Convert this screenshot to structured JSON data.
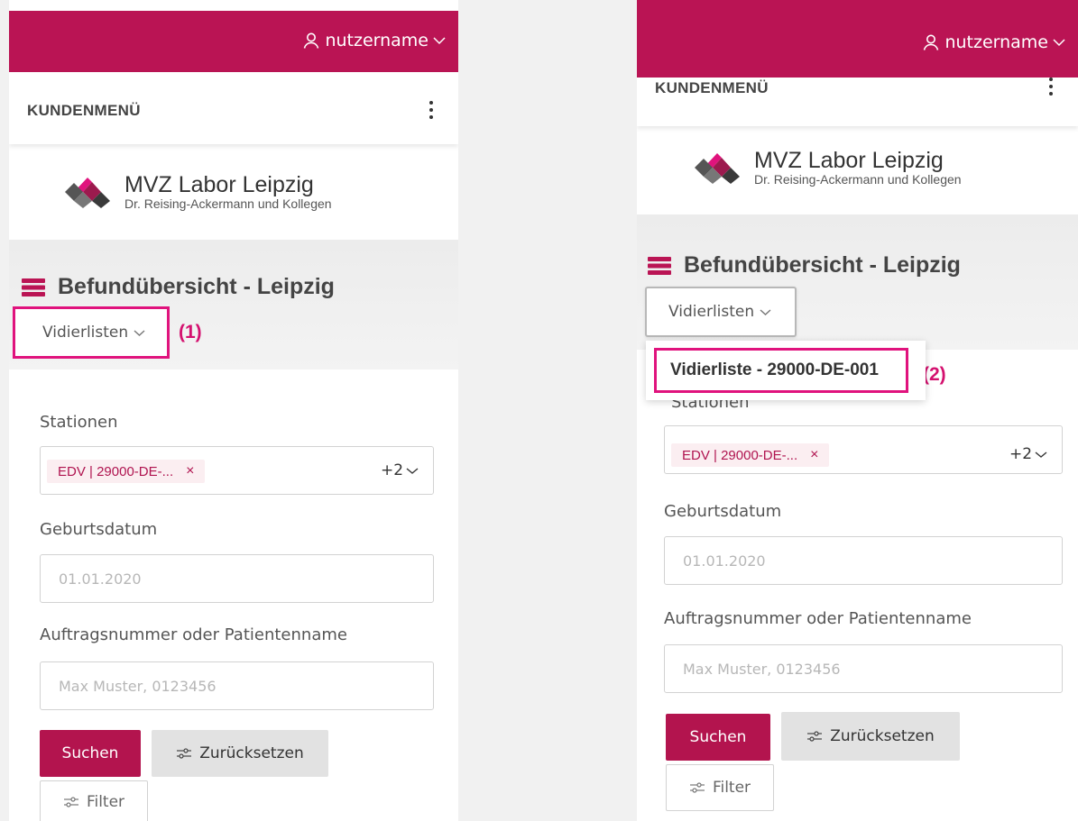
{
  "header": {
    "username": "nutzername"
  },
  "menu": {
    "title": "KUNDENMENÜ"
  },
  "logo": {
    "name": "MVZ Labor Leipzig",
    "subtitle": "Dr. Reising-Ackermann und Kollegen"
  },
  "page": {
    "title": "Befundübersicht - Leipzig"
  },
  "vidierlisten": {
    "label": "Vidierlisten",
    "items": [
      "Vidierliste - 29000-DE-001"
    ]
  },
  "annotations": [
    "(1)",
    "(2)"
  ],
  "form": {
    "stationen_label": "Stationen",
    "station_tag": "EDV | 29000-DE-...",
    "station_tag_remove": "×",
    "station_more": "+2",
    "geburtsdatum_label": "Geburtsdatum",
    "geburtsdatum_placeholder": "01.01.2020",
    "auftrag_label": "Auftragsnummer oder Patientenname",
    "auftrag_placeholder": "Max Muster, 0123456",
    "search_label": "Suchen",
    "reset_label": "Zurücksetzen",
    "filter_label": "Filter"
  },
  "colors": {
    "brand": "#ba1454",
    "highlight": "#e0137d",
    "tag_bg": "#fbeef1"
  }
}
